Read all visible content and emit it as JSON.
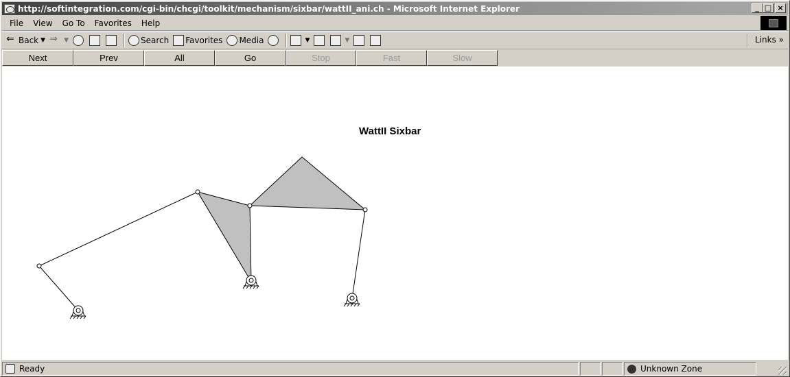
{
  "window": {
    "title": "http://softintegration.com/cgi-bin/chcgi/toolkit/mechanism/sixbar/wattII_ani.ch - Microsoft Internet Explorer",
    "controls": {
      "minimize": "_",
      "maximize": "□",
      "close": "×"
    }
  },
  "menu": [
    "File",
    "View",
    "Go To",
    "Favorites",
    "Help"
  ],
  "toolbar": {
    "back": "Back",
    "search": "Search",
    "favorites": "Favorites",
    "media": "Media",
    "links": "Links »"
  },
  "nav_buttons": [
    {
      "label": "Next",
      "enabled": true
    },
    {
      "label": "Prev",
      "enabled": true
    },
    {
      "label": "All",
      "enabled": true
    },
    {
      "label": "Go",
      "enabled": true
    },
    {
      "label": "Stop",
      "enabled": false
    },
    {
      "label": "Fast",
      "enabled": false
    },
    {
      "label": "Slow",
      "enabled": false
    }
  ],
  "page": {
    "heading": "WattII Sixbar"
  },
  "status": {
    "text": "Ready",
    "zone": "Unknown Zone"
  },
  "colors": {
    "link_fill": "#c0c0c0",
    "window_bg": "#d4d0c8",
    "content_bg": "#ffffff"
  }
}
